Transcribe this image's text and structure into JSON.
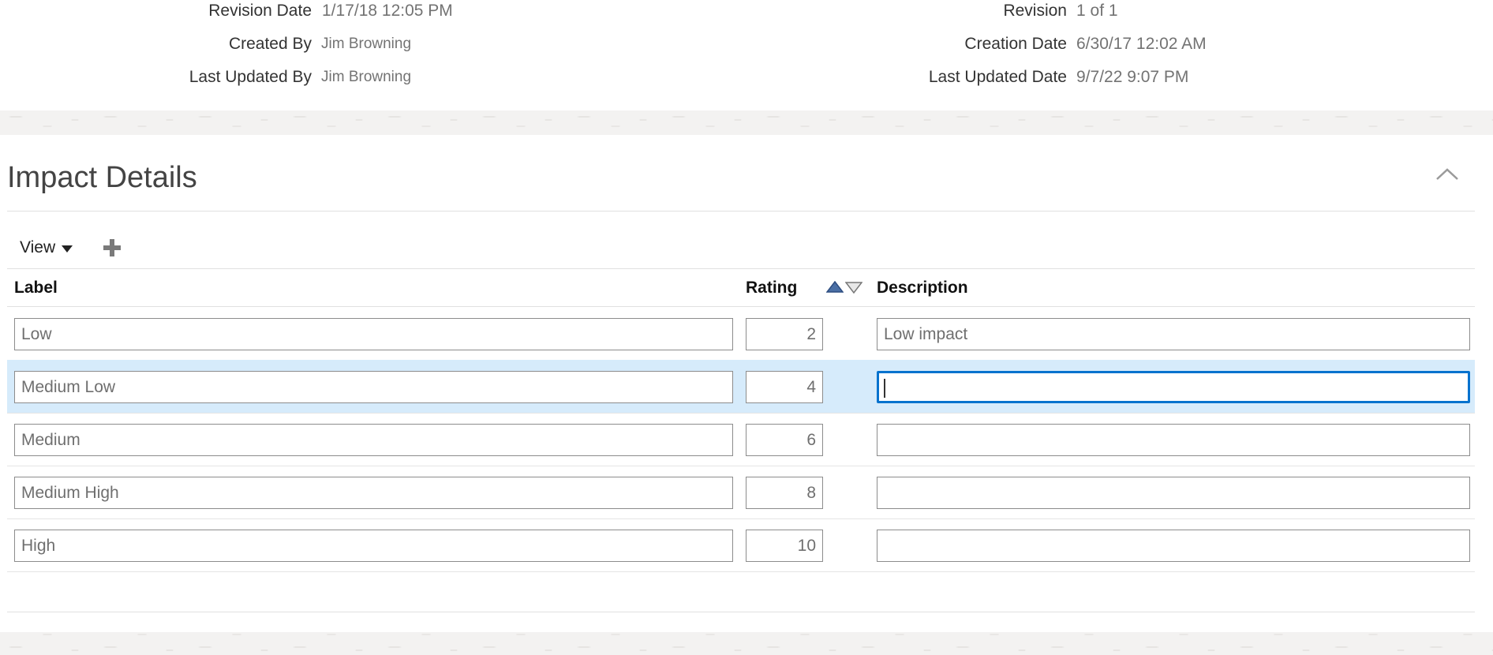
{
  "record_meta": {
    "revision_date_label": "Revision Date",
    "revision_date_value": "1/17/18 12:05 PM",
    "created_by_label": "Created By",
    "created_by_value": "Jim Browning",
    "last_updated_by_label": "Last Updated By",
    "last_updated_by_value": "Jim Browning",
    "revision_label": "Revision",
    "revision_value": "1 of 1",
    "creation_date_label": "Creation Date",
    "creation_date_value": "6/30/17 12:02 AM",
    "last_updated_date_label": "Last Updated Date",
    "last_updated_date_value": "9/7/22 9:07 PM"
  },
  "impact_section": {
    "title": "Impact Details",
    "toolbar": {
      "view_label": "View"
    },
    "columns": {
      "label": "Label",
      "rating": "Rating",
      "description": "Description"
    },
    "rows": [
      {
        "label": "Low",
        "rating": "2",
        "description": "Low impact"
      },
      {
        "label": "Medium Low",
        "rating": "4",
        "description": ""
      },
      {
        "label": "Medium",
        "rating": "6",
        "description": ""
      },
      {
        "label": "Medium High",
        "rating": "8",
        "description": ""
      },
      {
        "label": "High",
        "rating": "10",
        "description": ""
      }
    ],
    "selected_row_index": 1
  },
  "colors": {
    "selected_row": "#d6ebfb",
    "focus_border": "#0572ce",
    "sort_ascending_icon": "#4a6fa5"
  },
  "icons": {
    "view_dropdown": "caret-down-icon",
    "add": "plus-icon",
    "collapse": "chevron-up-icon",
    "sort_asc": "sort-ascending-icon",
    "sort_desc": "sort-descending-icon"
  }
}
